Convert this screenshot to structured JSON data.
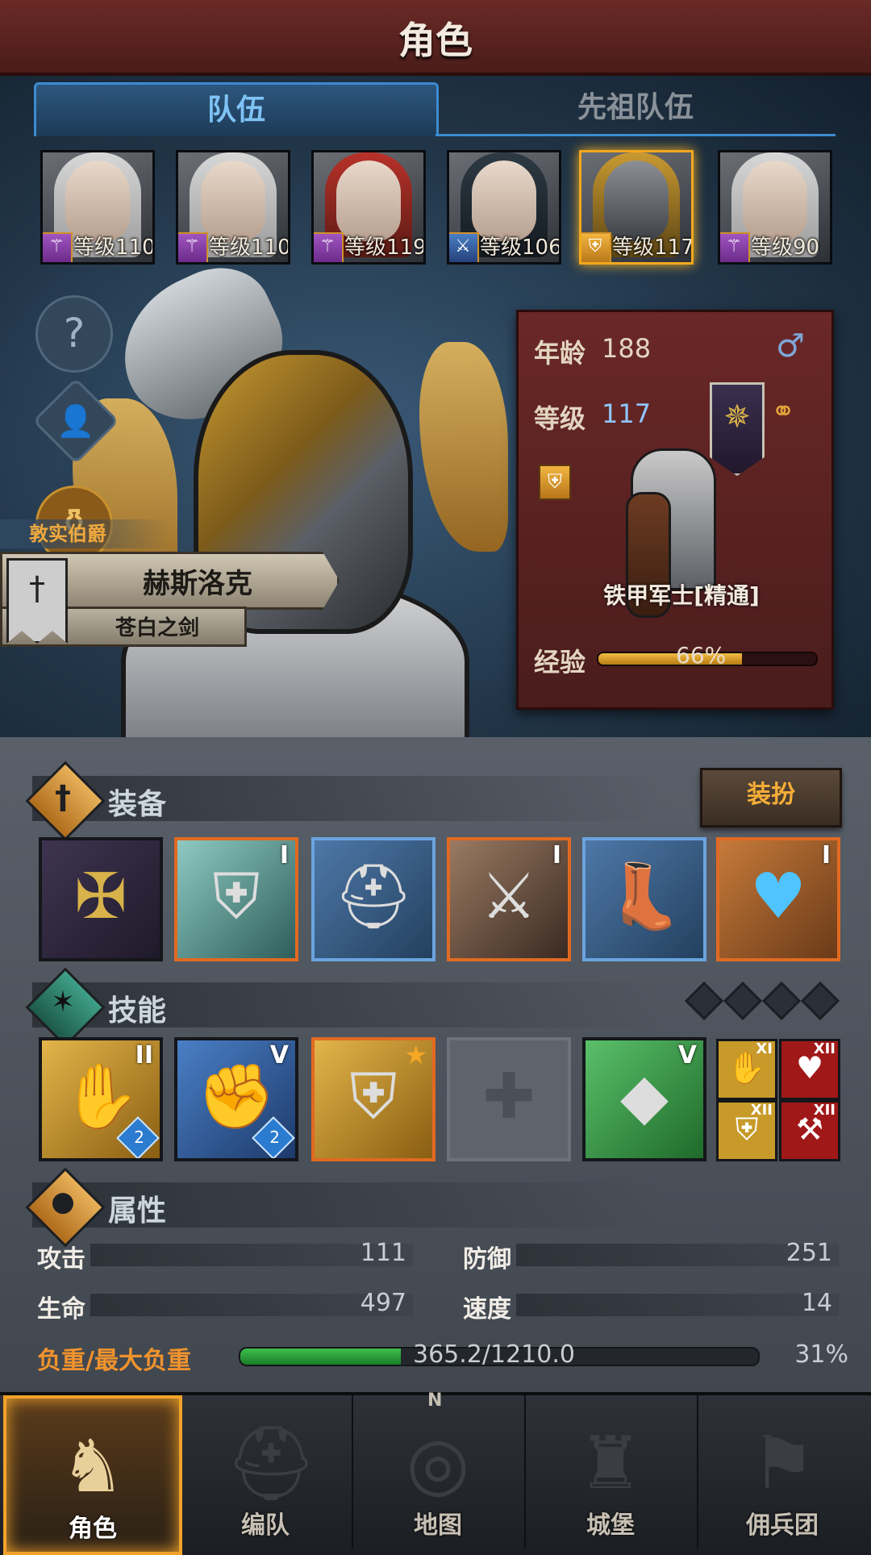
{
  "header": {
    "title": "角色"
  },
  "tabs": [
    {
      "label": "队伍",
      "active": true
    },
    {
      "label": "先祖队伍",
      "active": false
    }
  ],
  "party": [
    {
      "level_text": "等级110",
      "class_icon": "staff-icon",
      "selected": false
    },
    {
      "level_text": "等级110",
      "class_icon": "staff-icon",
      "selected": false
    },
    {
      "level_text": "等级119",
      "class_icon": "staff-icon",
      "selected": false
    },
    {
      "level_text": "等级106",
      "class_icon": "sword-icon",
      "selected": false
    },
    {
      "level_text": "等级117",
      "class_icon": "shield-icon",
      "selected": true
    },
    {
      "level_text": "等级90",
      "class_icon": "staff-icon",
      "selected": false
    }
  ],
  "hero": {
    "title": "敦实伯爵",
    "name": "赫斯洛克",
    "weapon": "苍白之剑"
  },
  "info": {
    "age_label": "年龄",
    "age_value": "188",
    "level_label": "等级",
    "level_value": "117",
    "unit_class": "铁甲军士[精通]",
    "exp_label": "经验",
    "exp_percent_text": "66%",
    "exp_fraction": 0.66,
    "gender_symbol": "♂"
  },
  "equipment": {
    "title": "装备",
    "dress_button": "装扮",
    "slots": [
      {
        "name": "banner",
        "glyph": "✠",
        "roman": "",
        "frame": "dark"
      },
      {
        "name": "shield",
        "glyph": "⛨",
        "roman": "I",
        "frame": "orange"
      },
      {
        "name": "helmet",
        "glyph": "⛑",
        "roman": "",
        "frame": "blue"
      },
      {
        "name": "armor",
        "glyph": "⚔",
        "roman": "I",
        "frame": "orange"
      },
      {
        "name": "boots",
        "glyph": "👢",
        "roman": "",
        "frame": "blue"
      },
      {
        "name": "amulet",
        "glyph": "♥",
        "roman": "I",
        "frame": "orange"
      }
    ]
  },
  "skills": {
    "title": "技能",
    "main": [
      {
        "glyph": "✋",
        "roman": "II",
        "rank": "2",
        "frame": "dark"
      },
      {
        "glyph": "✊",
        "roman": "V",
        "rank": "2",
        "frame": "dark"
      },
      {
        "glyph": "⛨",
        "roman": "",
        "rank": "",
        "frame": "orange"
      },
      {
        "glyph": "✚",
        "roman": "",
        "rank": "",
        "frame": "empty"
      },
      {
        "glyph": "◆",
        "roman": "V",
        "rank": "",
        "frame": "dark"
      }
    ],
    "mini": [
      {
        "glyph": "✋",
        "roman": "XI",
        "color": "#c79a2a"
      },
      {
        "glyph": "♥",
        "roman": "XII",
        "color": "#a01818"
      },
      {
        "glyph": "⛨",
        "roman": "XII",
        "color": "#c79a2a"
      },
      {
        "glyph": "⚒",
        "roman": "XII",
        "color": "#a01818"
      }
    ]
  },
  "attributes": {
    "title": "属性",
    "attack_label": "攻击",
    "attack_value": "111",
    "defense_label": "防御",
    "defense_value": "251",
    "hp_label": "生命",
    "hp_value": "497",
    "speed_label": "速度",
    "speed_value": "14",
    "load_label": "负重/最大负重",
    "load_value": "365.2/1210.0",
    "load_percent": "31%",
    "load_fraction": 0.31
  },
  "nav": [
    {
      "label": "角色",
      "icon": "knight-icon",
      "active": true
    },
    {
      "label": "编队",
      "icon": "helmet-icon",
      "active": false
    },
    {
      "label": "地图",
      "icon": "compass-icon",
      "active": false
    },
    {
      "label": "城堡",
      "icon": "castle-icon",
      "active": false
    },
    {
      "label": "佣兵团",
      "icon": "mercenary-icon",
      "active": false
    }
  ]
}
